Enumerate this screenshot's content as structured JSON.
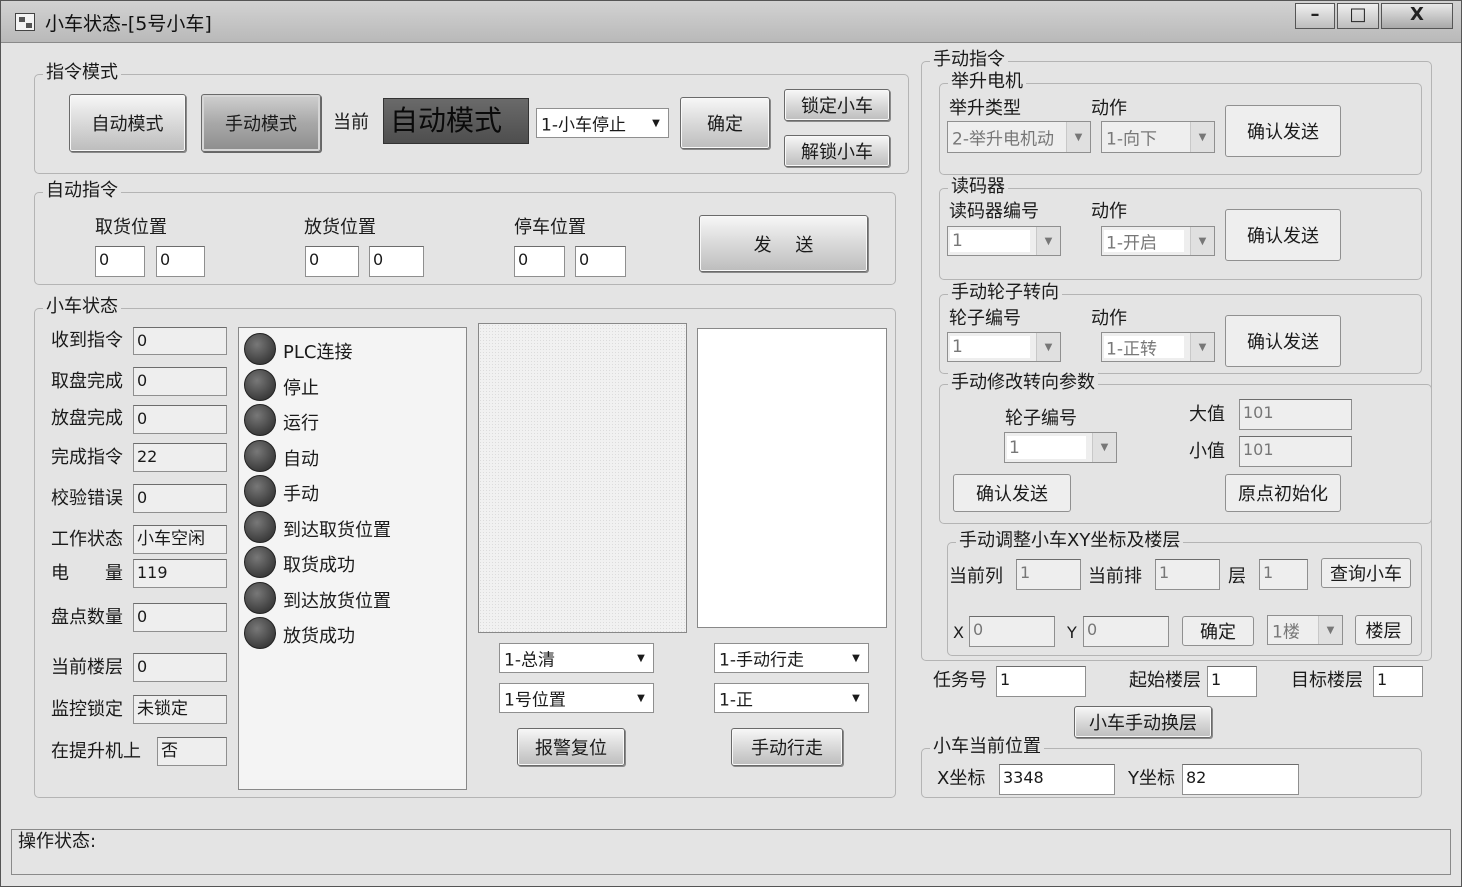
{
  "window": {
    "title": "小车状态-[5号小车]",
    "min": "–",
    "max": "□",
    "close": "X"
  },
  "cmd_mode": {
    "label": "指令模式",
    "auto_btn": "自动模式",
    "manual_btn": "手动模式",
    "current_label": "当前",
    "current_mode": "自动模式",
    "action_select": "1-小车停止",
    "confirm_btn": "确定",
    "lock_btn": "锁定小车",
    "unlock_btn": "解锁小车"
  },
  "auto_cmd": {
    "label": "自动指令",
    "pick_label": "取货位置",
    "place_label": "放货位置",
    "park_label": "停车位置",
    "pick_1": "0",
    "pick_2": "0",
    "place_1": "0",
    "place_2": "0",
    "park_1": "0",
    "park_2": "0",
    "send_btn": "发　 送"
  },
  "car_status": {
    "label": "小车状态",
    "fields": [
      {
        "label": "收到指令",
        "value": "0"
      },
      {
        "label": "取盘完成",
        "value": "0"
      },
      {
        "label": "放盘完成",
        "value": "0"
      },
      {
        "label": "完成指令",
        "value": "22"
      },
      {
        "label": "校验错误",
        "value": "0"
      },
      {
        "label": "工作状态",
        "value": "小车空闲"
      },
      {
        "label": "电　　量",
        "value": "119"
      },
      {
        "label": "盘点数量",
        "value": "0"
      },
      {
        "label": "当前楼层",
        "value": "0"
      },
      {
        "label": "监控锁定",
        "value": "未锁定"
      },
      {
        "label": "在提升机上",
        "value": "否"
      }
    ],
    "indicators": [
      "PLC连接",
      "停止",
      "运行",
      "自动",
      "手动",
      "到达取货位置",
      "取货成功",
      "到达放货位置",
      "放货成功"
    ],
    "clear_select": "1-总清",
    "position_select": "1号位置",
    "alarm_reset_btn": "报警复位",
    "walk_select": "1-手动行走",
    "direction_select": "1-正",
    "manual_walk_btn": "手动行走"
  },
  "manual_cmd": {
    "label": "手动指令",
    "lift_motor": {
      "label": "举升电机",
      "type_label": "举升类型",
      "action_label": "动作",
      "type_value": "2-举升电机动",
      "action_value": "1-向下",
      "send_btn": "确认发送"
    },
    "reader": {
      "label": "读码器",
      "id_label": "读码器编号",
      "action_label": "动作",
      "id_value": "1",
      "action_value": "1-开启",
      "send_btn": "确认发送"
    },
    "wheel": {
      "label": "手动轮子转向",
      "id_label": "轮子编号",
      "action_label": "动作",
      "id_value": "1",
      "action_value": "1-正转",
      "send_btn": "确认发送"
    },
    "steer_params": {
      "label": "手动修改转向参数",
      "wheel_label": "轮子编号",
      "wheel_value": "1",
      "max_label": "大值",
      "max_value": "101",
      "min_label": "小值",
      "min_value": "101",
      "send_btn": "确认发送",
      "init_btn": "原点初始化"
    },
    "xy_adjust": {
      "label": "手动调整小车XY坐标及楼层",
      "col_label": "当前列",
      "col_value": "1",
      "row_label": "当前排",
      "row_value": "1",
      "layer_label": "层",
      "layer_value": "1",
      "query_btn": "查询小车",
      "x_label": "X",
      "x_value": "0",
      "y_label": "Y",
      "y_value": "0",
      "confirm_btn": "确定",
      "floor_select": "1楼",
      "floor_btn": "楼层"
    }
  },
  "task": {
    "task_label": "任务号",
    "task_value": "1",
    "start_label": "起始楼层",
    "start_value": "1",
    "target_label": "目标楼层",
    "target_value": "1",
    "change_btn": "小车手动换层"
  },
  "position": {
    "label": "小车当前位置",
    "x_label": "X坐标",
    "x_value": "3348",
    "y_label": "Y坐标",
    "y_value": "82"
  },
  "op_status": {
    "label": "操作状态:"
  }
}
